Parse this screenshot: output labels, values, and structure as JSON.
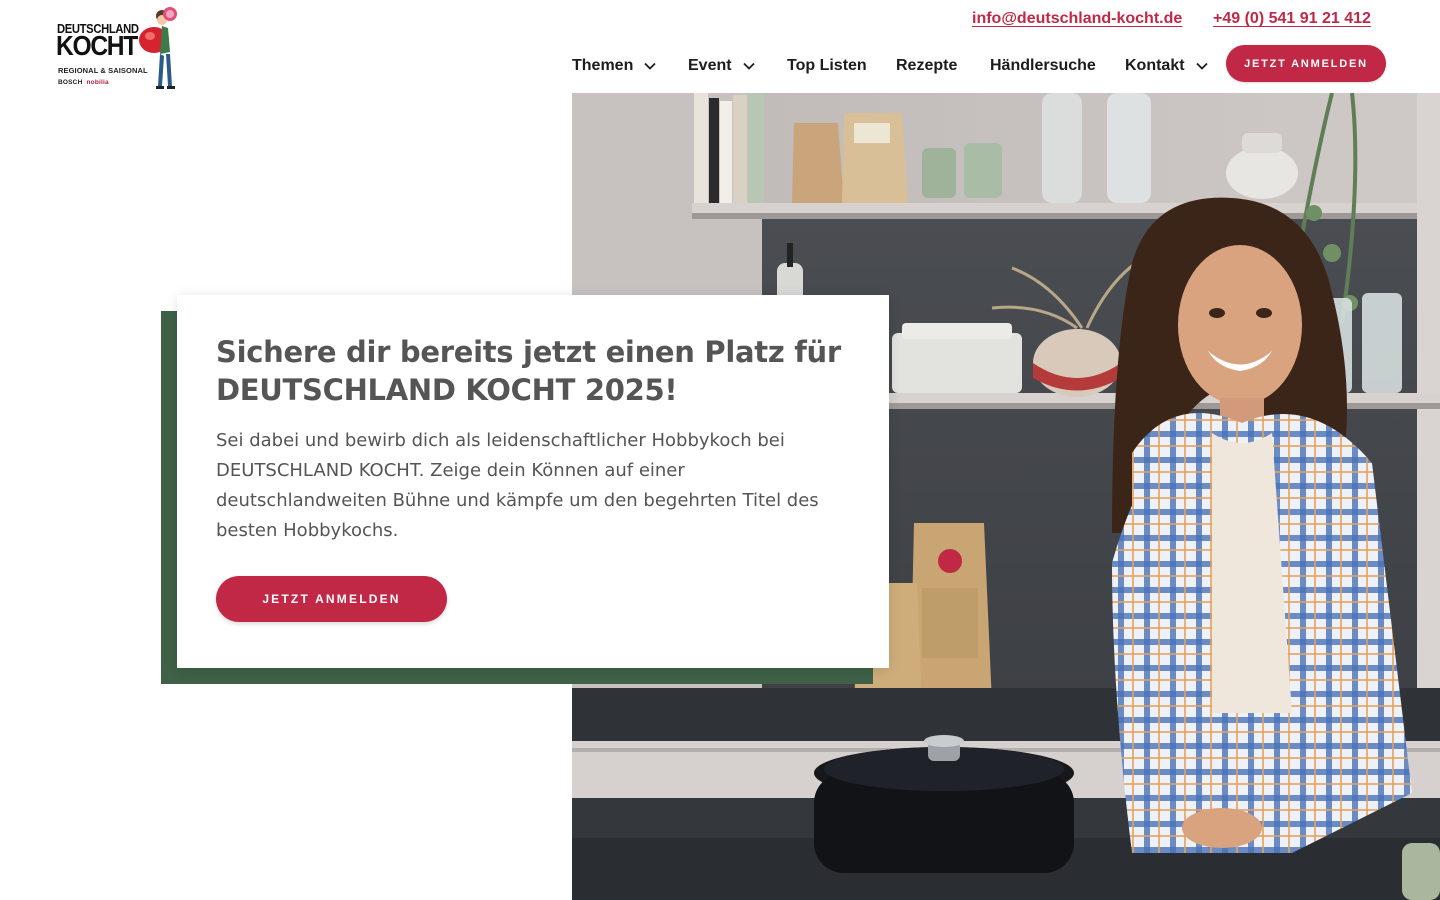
{
  "header": {
    "logo": {
      "line1": "DEUTSCHLAND",
      "line2": "KOCHT",
      "line3": "REGIONAL & SAISONAL",
      "partner1": "BOSCH",
      "partner2": "nobilia"
    },
    "contact_email": "info@deutschland-kocht.de",
    "contact_phone": "+49 (0) 541 91 21 412",
    "nav": [
      {
        "label": "Themen",
        "has_dropdown": true
      },
      {
        "label": "Event",
        "has_dropdown": true
      },
      {
        "label": "Top Listen",
        "has_dropdown": false
      },
      {
        "label": "Rezepte",
        "has_dropdown": false
      },
      {
        "label": "Händlersuche",
        "has_dropdown": false
      },
      {
        "label": "Kontakt",
        "has_dropdown": true
      }
    ],
    "cta_label": "JETZT ANMELDEN"
  },
  "hero": {
    "title": "Sichere dir bereits jetzt einen Platz für DEUTSCHLAND KOCHT 2025!",
    "text": "Sei dabei und bewirb dich als leidenschaftlicher Hobbykoch bei DEUTSCHLAND KOCHT. Zeige dein Können auf einer deutschlandweiten Bühne und kämpfe um den begehrten Titel des besten Hobbykochs.",
    "cta_label": "JETZT ANMELDEN",
    "image": "hero-kitchen-photo"
  },
  "colors": {
    "accent": "#c02846",
    "card_border": "#3e6147",
    "text": "#555555"
  }
}
